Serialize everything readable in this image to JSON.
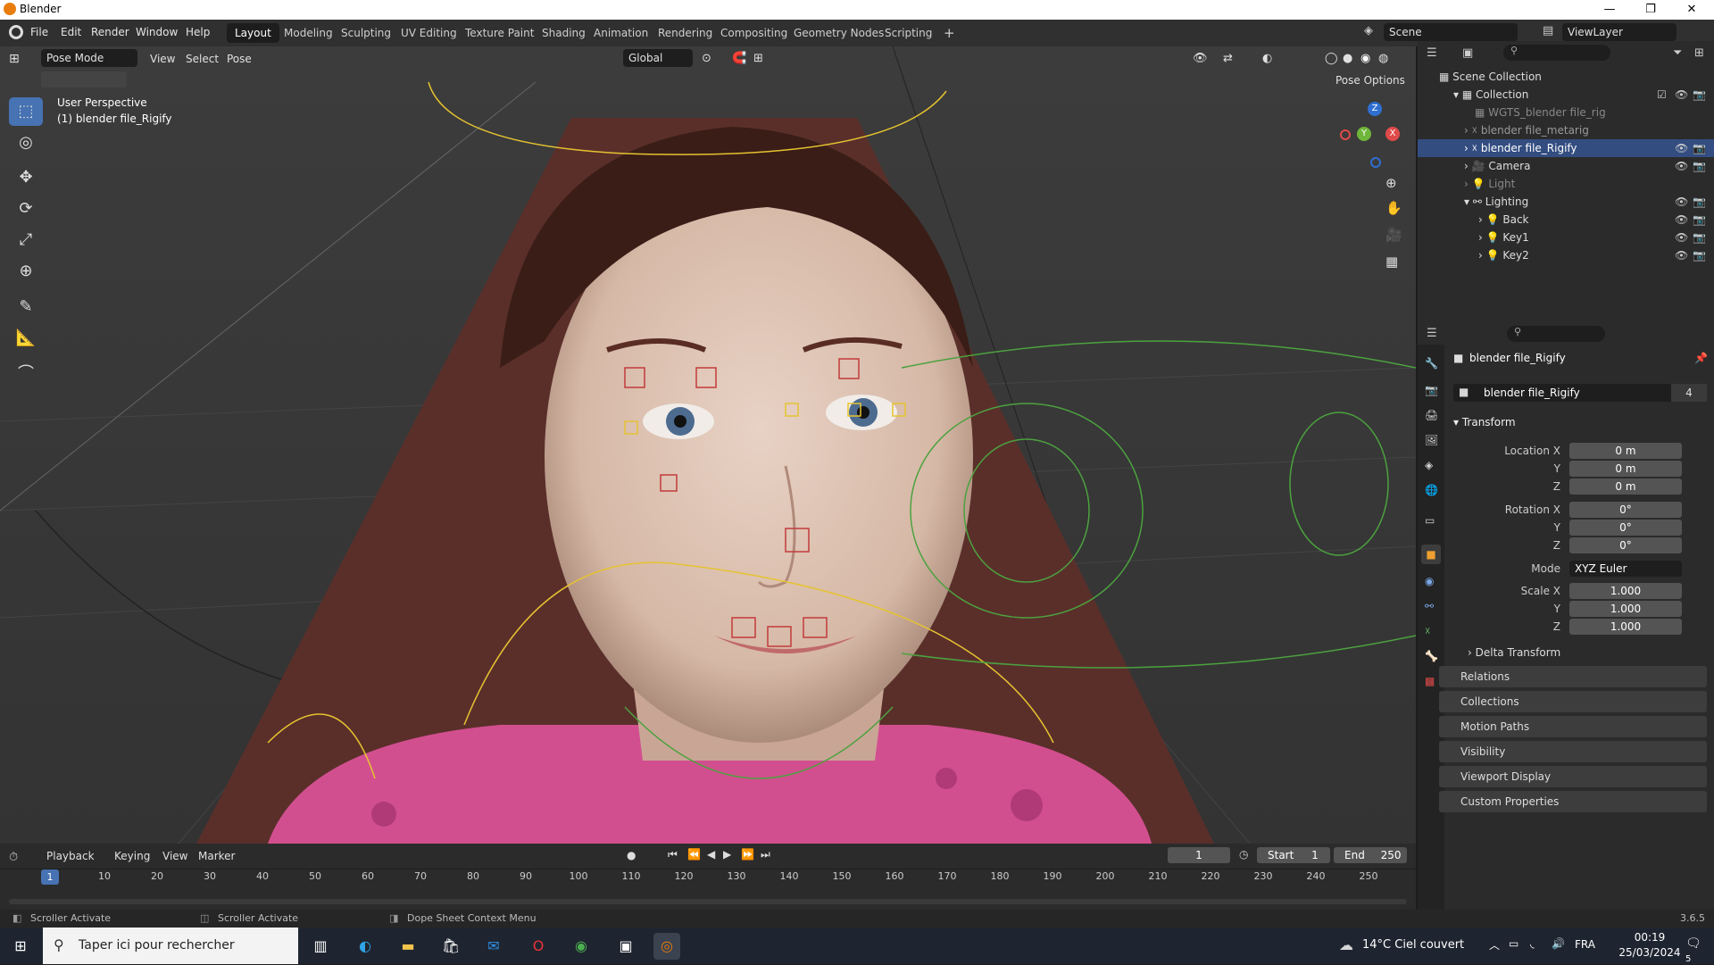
{
  "window": {
    "title": "Blender"
  },
  "menus": [
    "File",
    "Edit",
    "Render",
    "Window",
    "Help"
  ],
  "workspaces": [
    "Layout",
    "Modeling",
    "Sculpting",
    "UV Editing",
    "Texture Paint",
    "Shading",
    "Animation",
    "Rendering",
    "Compositing",
    "Geometry Nodes",
    "Scripting"
  ],
  "scene": {
    "name": "Scene",
    "view_layer": "ViewLayer"
  },
  "viewport": {
    "mode": "Pose Mode",
    "menus": [
      "View",
      "Select",
      "Pose"
    ],
    "orientation": "Global",
    "pose_options": "Pose Options",
    "overlay_title": "User Perspective",
    "overlay_object": "(1) blender file_Rigify",
    "gizmo_x": "X",
    "gizmo_y": "Y",
    "gizmo_z": "Z"
  },
  "outliner": {
    "root": "Scene Collection",
    "items": [
      {
        "name": "Collection",
        "depth": 1
      },
      {
        "name": "WGTS_blender file_rig",
        "depth": 2
      },
      {
        "name": "blender file_metarig",
        "depth": 2
      },
      {
        "name": "blender file_Rigify",
        "depth": 2,
        "selected": true
      },
      {
        "name": "Camera",
        "depth": 2
      },
      {
        "name": "Light",
        "depth": 2
      },
      {
        "name": "Lighting",
        "depth": 2
      },
      {
        "name": "Back",
        "depth": 3
      },
      {
        "name": "Key1",
        "depth": 3
      },
      {
        "name": "Key2",
        "depth": 3
      }
    ]
  },
  "properties": {
    "object_name": "blender file_Rigify",
    "data_name": "blender file_Rigify",
    "users": "4",
    "transform_label": "Transform",
    "location": {
      "label": "Location X",
      "x": "0 m",
      "y": "0 m",
      "z": "0 m"
    },
    "rotation": {
      "label": "Rotation X",
      "x": "0°",
      "y": "0°",
      "z": "0°"
    },
    "mode_label": "Mode",
    "mode": "XYZ Euler",
    "scale": {
      "label": "Scale X",
      "x": "1.000",
      "y": "1.000",
      "z": "1.000"
    },
    "axis_y": "Y",
    "axis_z": "Z",
    "panels": [
      "Delta Transform",
      "Relations",
      "Collections",
      "Motion Paths",
      "Visibility",
      "Viewport Display",
      "Custom Properties"
    ]
  },
  "timeline": {
    "menus": [
      "Playback",
      "Keying",
      "View",
      "Marker"
    ],
    "current_frame": "1",
    "start_label": "Start",
    "start": "1",
    "end_label": "End",
    "end": "250",
    "ticks": [
      "10",
      "20",
      "30",
      "40",
      "50",
      "60",
      "70",
      "80",
      "90",
      "100",
      "110",
      "120",
      "130",
      "140",
      "150",
      "160",
      "170",
      "180",
      "190",
      "200",
      "210",
      "220",
      "230",
      "240",
      "250"
    ],
    "playhead": "1"
  },
  "status": {
    "left": "Scroller Activate",
    "middle": "Scroller Activate",
    "right": "Dope Sheet Context Menu",
    "version": "3.6.5"
  },
  "taskbar": {
    "search_placeholder": "Taper ici pour rechercher",
    "weather": "14°C  Ciel couvert",
    "lang": "FRA",
    "time": "00:19",
    "date": "25/03/2024",
    "notifications": "5"
  }
}
